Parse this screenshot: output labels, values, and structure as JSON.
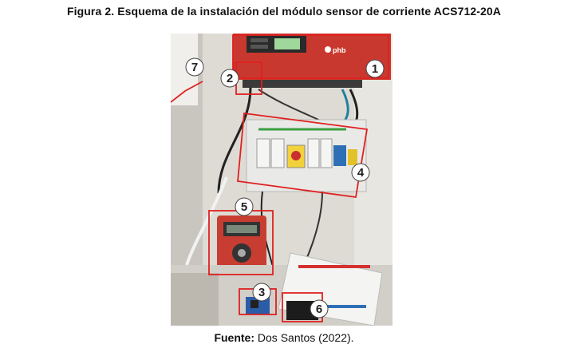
{
  "figure": {
    "caption": "Figura 2. Esquema de la instalación del módulo sensor de corriente ACS712-20A",
    "source_label": "Fuente:",
    "source_text": "Dos Santos (2022).",
    "photo": {
      "device_brand": "phb",
      "callout_numbers": [
        "1",
        "2",
        "3",
        "4",
        "5",
        "6",
        "7"
      ],
      "highlight_color": "#e02020"
    }
  }
}
